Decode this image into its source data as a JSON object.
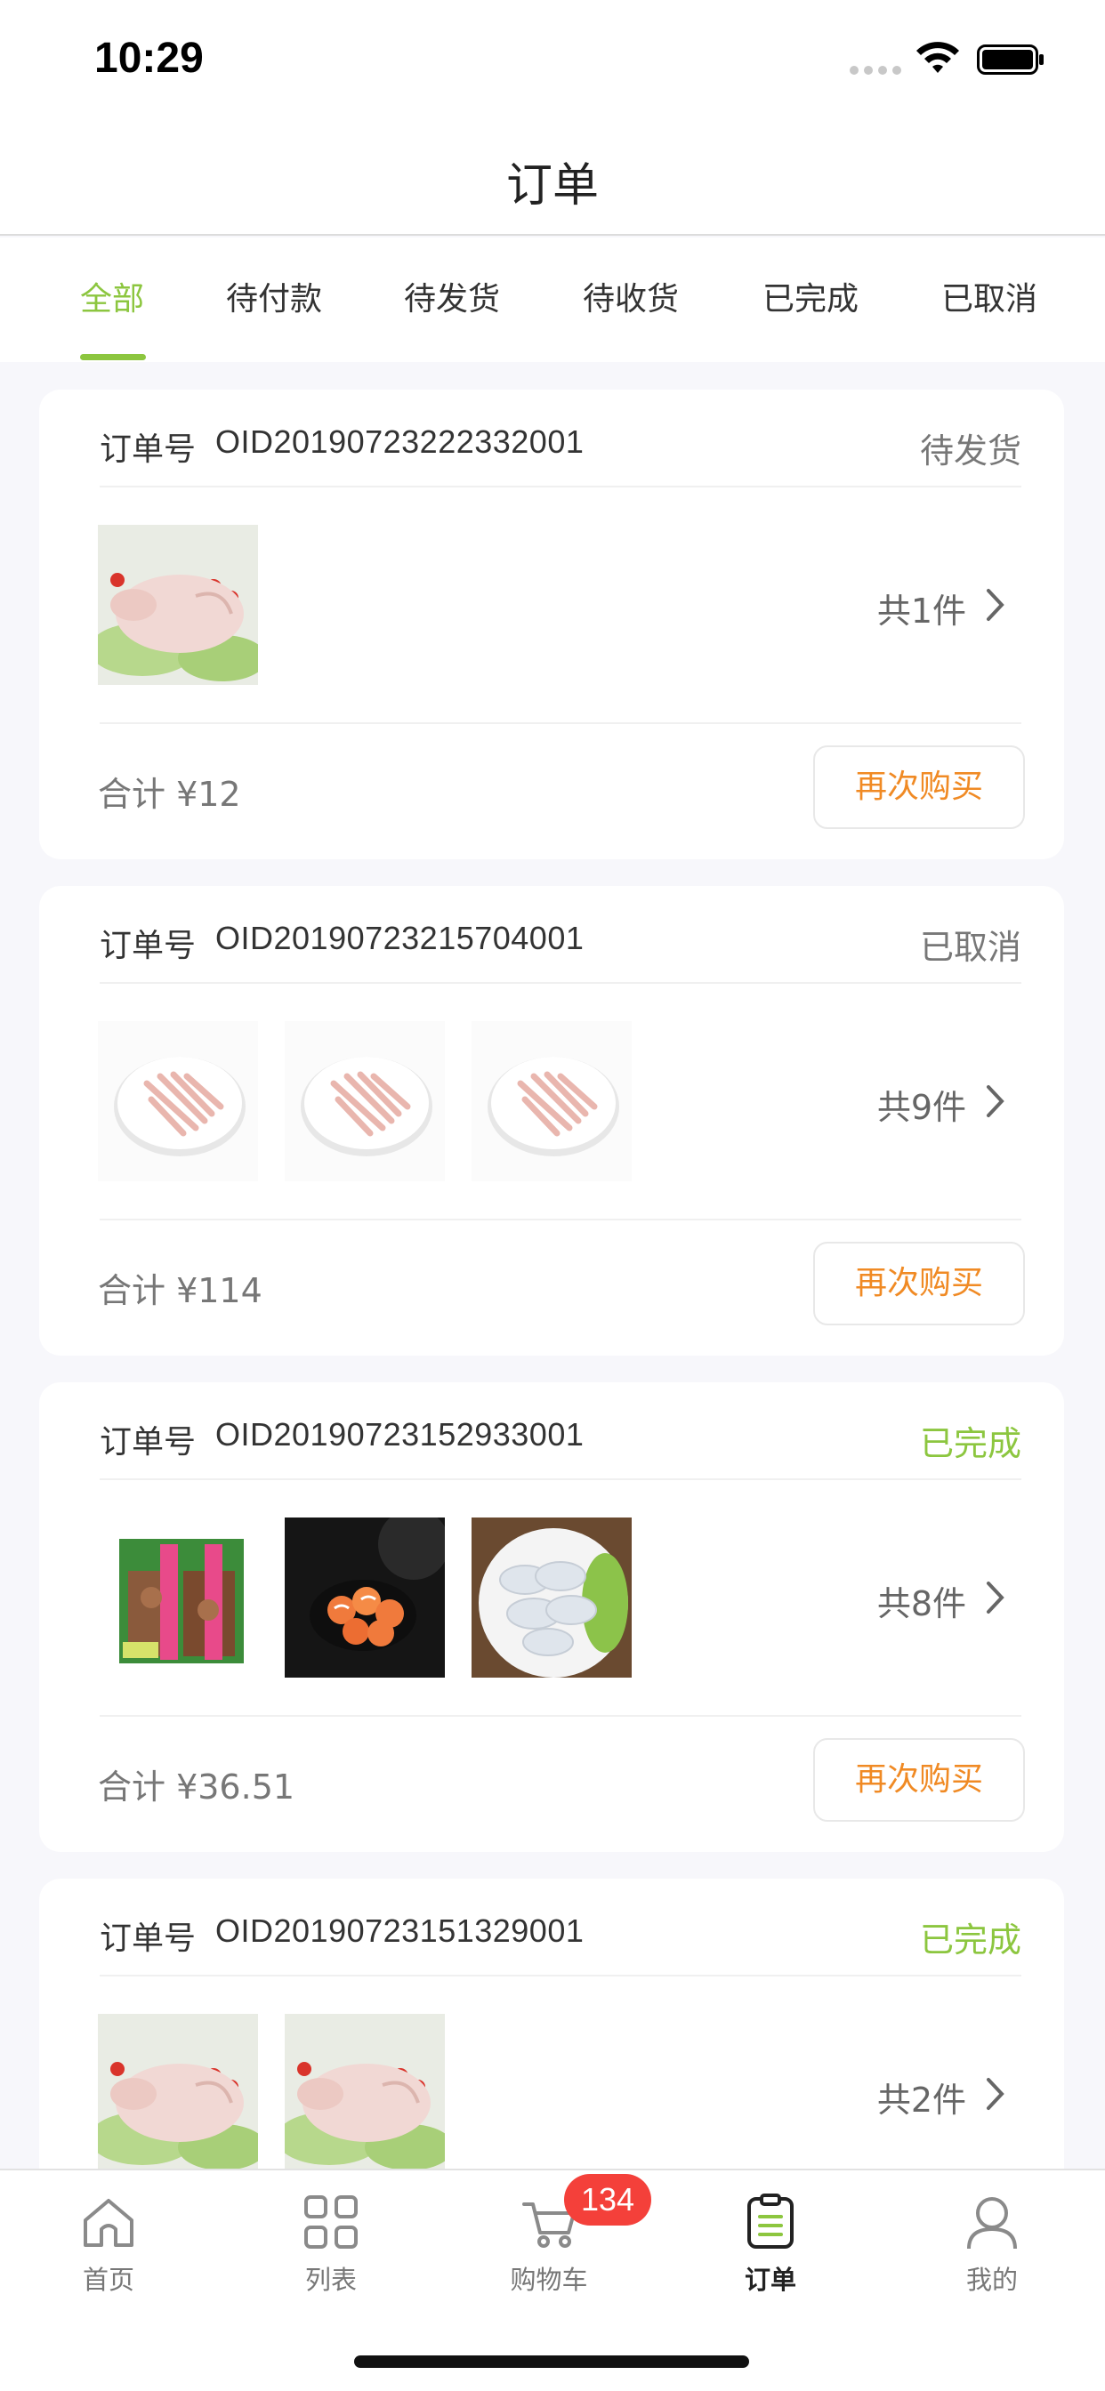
{
  "status_bar": {
    "time": "10:29"
  },
  "header": {
    "title": "订单"
  },
  "tabs": [
    {
      "label": "全部",
      "active": true
    },
    {
      "label": "待付款"
    },
    {
      "label": "待发货"
    },
    {
      "label": "待收货"
    },
    {
      "label": "已完成"
    },
    {
      "label": "已取消"
    }
  ],
  "orders": [
    {
      "oid_label": "订单号",
      "oid": "OID20190723222332001",
      "status": "待发货",
      "count": "共1件",
      "total": "合计 ¥12",
      "rebuy": "再次购买",
      "thumbs": [
        "whole-duck"
      ]
    },
    {
      "oid_label": "订单号",
      "oid": "OID20190723215704001",
      "status": "已取消",
      "count": "共9件",
      "total": "合计 ¥114",
      "rebuy": "再次购买",
      "thumbs": [
        "duck-feet",
        "duck-feet",
        "duck-feet"
      ]
    },
    {
      "oid_label": "订单号",
      "oid": "OID20190723152933001",
      "status": "已完成",
      "count": "共8件",
      "total": "合计 ¥36.51",
      "rebuy": "再次购买",
      "thumbs": [
        "mushroom-pack",
        "salmon-balls",
        "shrimp"
      ]
    },
    {
      "oid_label": "订单号",
      "oid": "OID20190723151329001",
      "status": "已完成",
      "count": "共2件",
      "thumbs": [
        "whole-duck",
        "whole-duck"
      ]
    }
  ],
  "tab_bar": {
    "items": [
      {
        "label": "首页",
        "icon": "home-icon"
      },
      {
        "label": "列表",
        "icon": "grid-icon"
      },
      {
        "label": "购物车",
        "icon": "cart-icon"
      },
      {
        "label": "订单",
        "icon": "order-icon",
        "active": true
      },
      {
        "label": "我的",
        "icon": "user-icon"
      }
    ],
    "cart_badge": "134"
  },
  "colors": {
    "accent": "#8cc63f",
    "rebuy_text": "#f08a24",
    "badge": "#f4403a"
  }
}
